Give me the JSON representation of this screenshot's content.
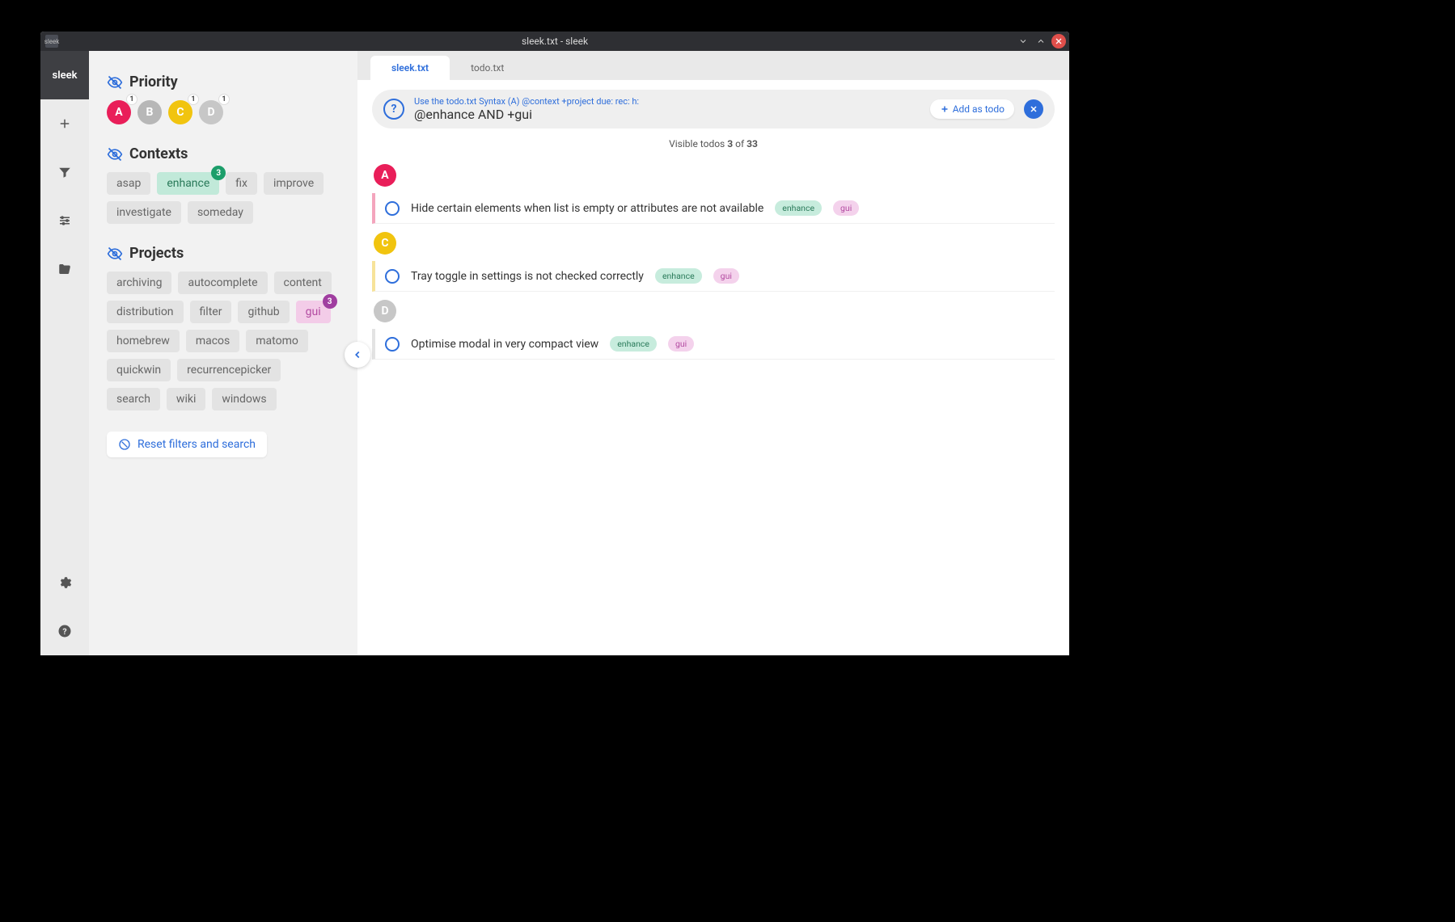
{
  "window": {
    "title": "sleek.txt - sleek",
    "app_icon_label": "sleek"
  },
  "rail": {
    "logo": "sleek"
  },
  "sidebar": {
    "priority": {
      "title": "Priority",
      "items": [
        {
          "letter": "A",
          "badge": "1"
        },
        {
          "letter": "B"
        },
        {
          "letter": "C",
          "badge": "1"
        },
        {
          "letter": "D",
          "badge": "1"
        }
      ]
    },
    "contexts": {
      "title": "Contexts",
      "items": [
        {
          "label": "asap"
        },
        {
          "label": "enhance",
          "selected": true,
          "badge": "3"
        },
        {
          "label": "fix"
        },
        {
          "label": "improve"
        },
        {
          "label": "investigate"
        },
        {
          "label": "someday"
        }
      ]
    },
    "projects": {
      "title": "Projects",
      "items": [
        {
          "label": "archiving"
        },
        {
          "label": "autocomplete"
        },
        {
          "label": "content"
        },
        {
          "label": "distribution"
        },
        {
          "label": "filter"
        },
        {
          "label": "github"
        },
        {
          "label": "gui",
          "selected": true,
          "badge": "3"
        },
        {
          "label": "homebrew"
        },
        {
          "label": "macos"
        },
        {
          "label": "matomo"
        },
        {
          "label": "quickwin"
        },
        {
          "label": "recurrencepicker"
        },
        {
          "label": "search"
        },
        {
          "label": "wiki"
        },
        {
          "label": "windows"
        }
      ]
    },
    "reset": "Reset filters and search"
  },
  "tabs": [
    {
      "label": "sleek.txt",
      "active": true
    },
    {
      "label": "todo.txt"
    }
  ],
  "search": {
    "hint": "Use the todo.txt Syntax (A) @context +project due: rec: h:",
    "query": "@enhance AND +gui",
    "add_label": "Add as todo"
  },
  "count": {
    "prefix": "Visible todos ",
    "shown": "3",
    "mid": " of ",
    "total": "33"
  },
  "groups": [
    {
      "letter": "A",
      "rows": [
        {
          "text": "Hide certain elements when list is empty or attributes are not available",
          "ctx": "enhance",
          "proj": "gui"
        }
      ]
    },
    {
      "letter": "C",
      "rows": [
        {
          "text": "Tray toggle in settings is not checked correctly",
          "ctx": "enhance",
          "proj": "gui"
        }
      ]
    },
    {
      "letter": "D",
      "rows": [
        {
          "text": "Optimise modal in very compact view",
          "ctx": "enhance",
          "proj": "gui"
        }
      ]
    }
  ]
}
